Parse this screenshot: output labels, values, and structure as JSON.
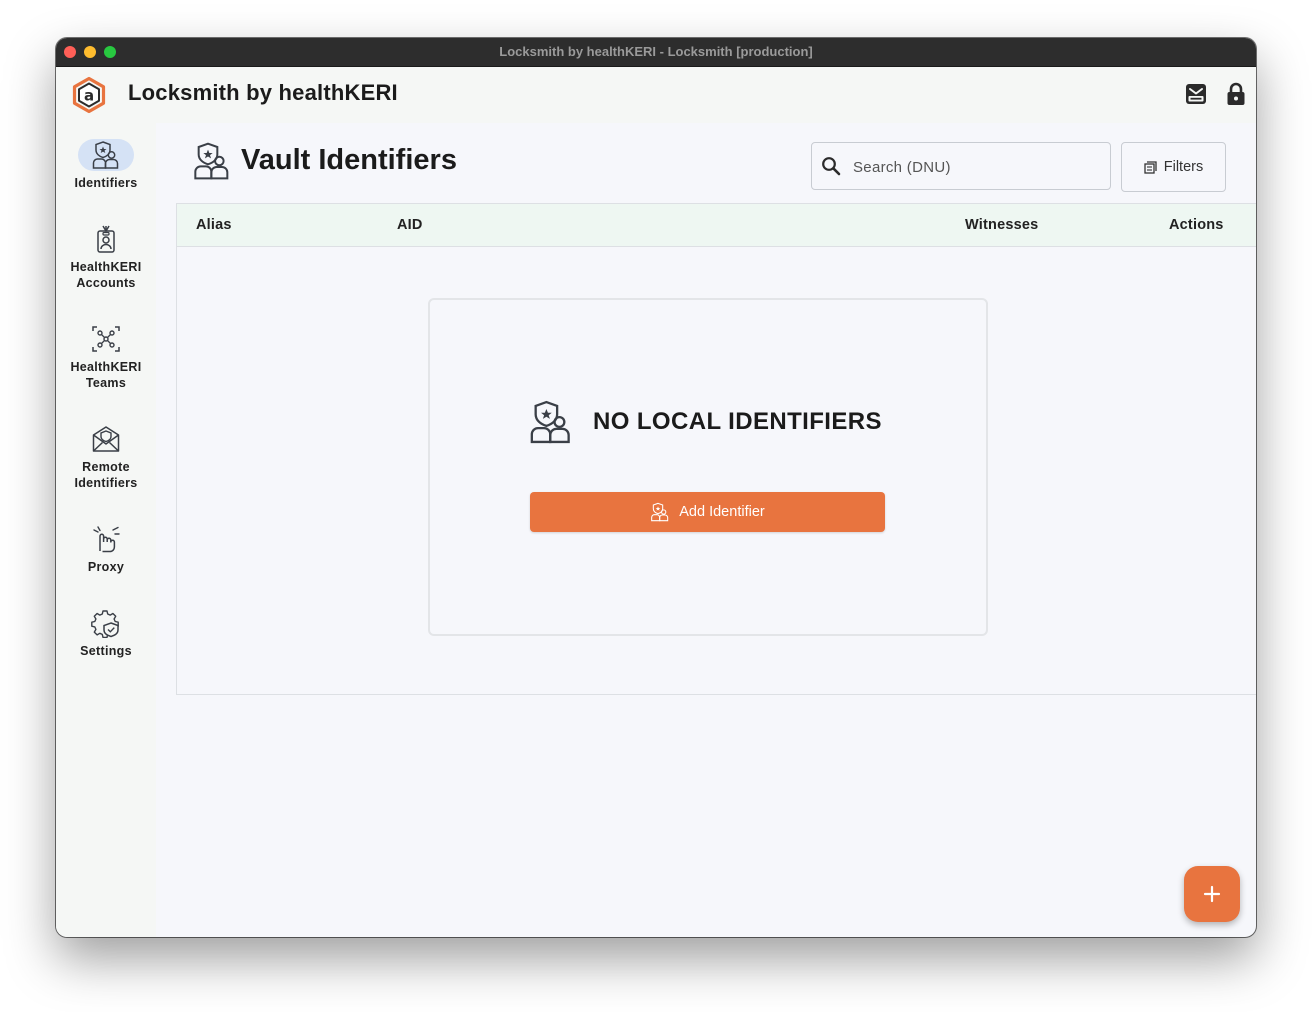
{
  "window": {
    "title": "Locksmith by healthKERI - Locksmith [production]"
  },
  "appbar": {
    "title": "Locksmith by healthKERI",
    "logo_icon": "hexagon-a-logo",
    "actions": [
      "inbox-icon",
      "lock-icon"
    ]
  },
  "sidebar": {
    "items": [
      {
        "label": "Identifiers",
        "icon": "identifiers-icon",
        "active": true
      },
      {
        "label": "HealthKERI Accounts",
        "icon": "badge-icon",
        "active": false
      },
      {
        "label": "HealthKERI Teams",
        "icon": "network-icon",
        "active": false
      },
      {
        "label": "Remote Identifiers",
        "icon": "mail-shield-icon",
        "active": false
      },
      {
        "label": "Proxy",
        "icon": "hand-pointer-icon",
        "active": false
      },
      {
        "label": "Settings",
        "icon": "gear-shield-icon",
        "active": false
      }
    ]
  },
  "page": {
    "title": "Vault Identifiers",
    "search": {
      "placeholder": "Search (DNU)",
      "value": ""
    },
    "filters_label": "Filters",
    "table": {
      "columns": [
        "Alias",
        "AID",
        "Witnesses",
        "Actions"
      ],
      "rows": []
    },
    "empty_state": {
      "title": "NO LOCAL IDENTIFIERS",
      "button_label": "Add Identifier"
    },
    "fab_label": "+"
  },
  "colors": {
    "accent": "#e8743f",
    "active_nav_bg": "#d5e2f5",
    "table_header_bg": "#eef7f2"
  }
}
